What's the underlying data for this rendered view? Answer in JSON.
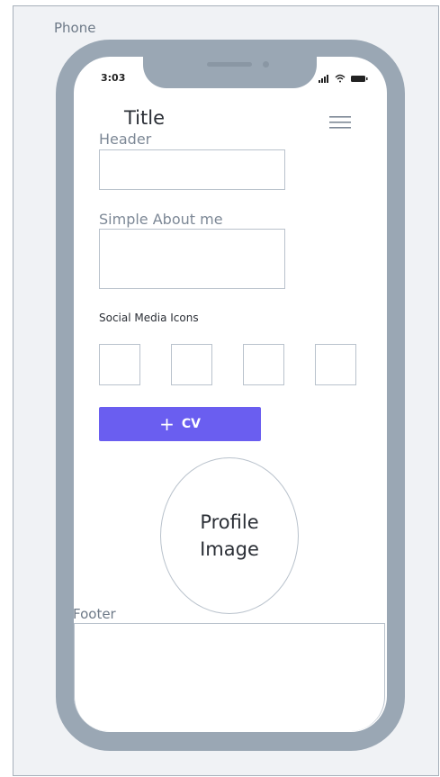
{
  "frame": {
    "label": "Phone"
  },
  "status_bar": {
    "time": "3:03",
    "icons": [
      "signal-icon",
      "wifi-icon",
      "battery-icon"
    ]
  },
  "app": {
    "title": "Title",
    "menu_icon": "hamburger-menu-icon"
  },
  "form": {
    "header_label": "Header",
    "header_value": "",
    "about_label": "Simple About me",
    "about_value": "",
    "social_label": "Social Media Icons",
    "social_slots": 4
  },
  "cv_button": {
    "icon": "+",
    "label": "CV",
    "color": "#6a5ef0"
  },
  "profile": {
    "line1": "Profile",
    "line2": "Image"
  },
  "footer": {
    "label": "Footer"
  },
  "colors": {
    "phone_body": "#9aa7b4",
    "canvas": "#f0f2f5",
    "accent": "#6a5ef0"
  }
}
